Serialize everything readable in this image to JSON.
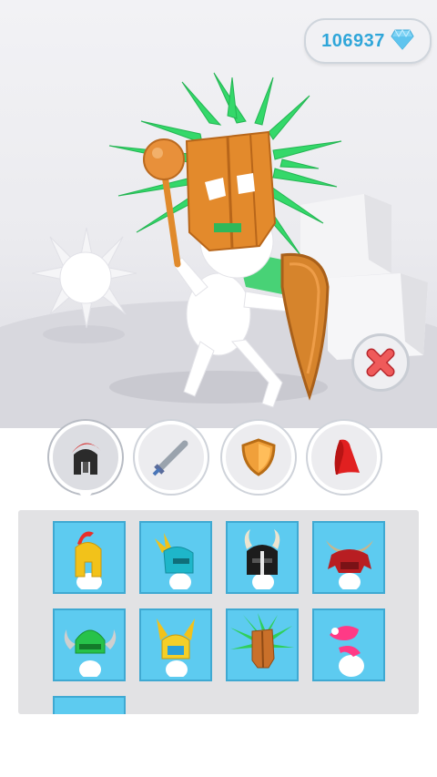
{
  "currency": {
    "amount": "106937",
    "icon": "diamond-icon",
    "color": "#2fa6d9"
  },
  "scene": {
    "character": "player-character",
    "equipped": [
      "tiki-mask",
      "mace",
      "wooden-shield"
    ],
    "props": [
      "spiked-ball",
      "white-blocks"
    ]
  },
  "close_button": {
    "icon": "close-x-icon",
    "color": "#e04a4a"
  },
  "tabs": [
    {
      "id": "helmets",
      "icon": "spartan-helmet-icon",
      "active": true
    },
    {
      "id": "weapons",
      "icon": "sword-icon",
      "active": false
    },
    {
      "id": "shields",
      "icon": "shield-icon",
      "active": false
    },
    {
      "id": "capes",
      "icon": "cape-icon",
      "active": false
    }
  ],
  "items": [
    {
      "id": "gold-spartan-helmet",
      "icon": "gold-spartan-helmet-icon"
    },
    {
      "id": "winged-helmet",
      "icon": "winged-helmet-icon"
    },
    {
      "id": "horned-black-helmet",
      "icon": "horned-black-helmet-icon"
    },
    {
      "id": "samurai-helmet",
      "icon": "samurai-helmet-icon"
    },
    {
      "id": "green-viking-helmet",
      "icon": "green-viking-helmet-icon"
    },
    {
      "id": "valkyrie-helmet",
      "icon": "valkyrie-helmet-icon"
    },
    {
      "id": "tiki-mask",
      "icon": "tiki-mask-icon"
    },
    {
      "id": "pink-hat",
      "icon": "pink-hat-icon"
    },
    {
      "id": "locked-item",
      "icon": "partial-item-icon"
    }
  ]
}
